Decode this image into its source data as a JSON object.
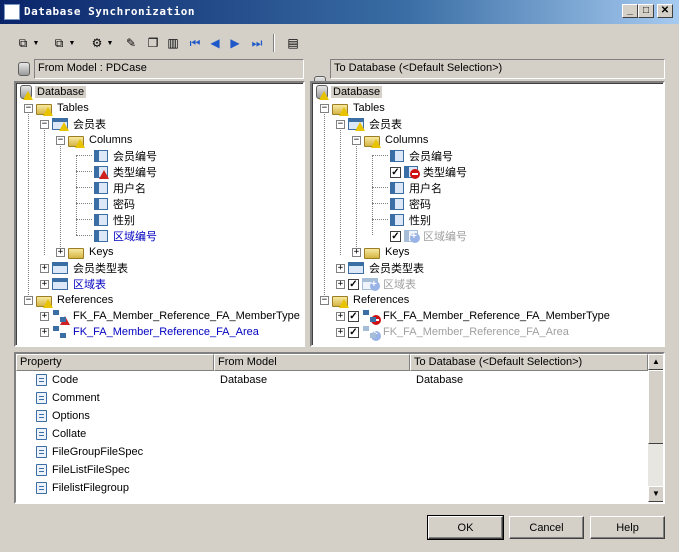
{
  "window": {
    "title": "Database Synchronization",
    "minimize_glyph": "_",
    "maximize_glyph": "□",
    "close_glyph": "✕"
  },
  "toolbar": {
    "icons": [
      "merge-icon",
      "dropdown-arrow",
      "compare-icon",
      "dropdown-arrow",
      "filter-icon",
      "dropdown-arrow",
      "properties-icon",
      "copy-icon",
      "columns-icon",
      "first-icon",
      "previous-icon",
      "next-icon",
      "last-icon",
      "report-icon"
    ]
  },
  "left_header": "From Model : PDCase",
  "right_header": "To Database (<Default Selection>)",
  "left_tree": [
    {
      "label": "Database"
    },
    {
      "label": "Tables"
    },
    {
      "label": "会员表"
    },
    {
      "label": "Columns"
    },
    {
      "label": "会员编号"
    },
    {
      "label": "类型编号"
    },
    {
      "label": "用户名"
    },
    {
      "label": "密码"
    },
    {
      "label": "性别"
    },
    {
      "label": "区域编号"
    },
    {
      "label": "Keys"
    },
    {
      "label": "会员类型表"
    },
    {
      "label": "区域表"
    },
    {
      "label": "References"
    },
    {
      "label": "FK_FA_Member_Reference_FA_MemberType"
    },
    {
      "label": "FK_FA_Member_Reference_FA_Area"
    }
  ],
  "right_tree": [
    {
      "label": "Database"
    },
    {
      "label": "Tables"
    },
    {
      "label": "会员表"
    },
    {
      "label": "Columns"
    },
    {
      "label": "会员编号"
    },
    {
      "label": "类型编号"
    },
    {
      "label": "用户名"
    },
    {
      "label": "密码"
    },
    {
      "label": "性别"
    },
    {
      "label": "区域编号"
    },
    {
      "label": "Keys"
    },
    {
      "label": "会员类型表"
    },
    {
      "label": "区域表"
    },
    {
      "label": "References"
    },
    {
      "label": "FK_FA_Member_Reference_FA_MemberType"
    },
    {
      "label": "FK_FA_Member_Reference_FA_Area"
    }
  ],
  "grid": {
    "columns": [
      "Property",
      "From Model",
      "To Database (<Default Selection>)"
    ],
    "rows": [
      {
        "property": "Code",
        "from": "Database",
        "to": "Database"
      },
      {
        "property": "Comment",
        "from": "",
        "to": ""
      },
      {
        "property": "Options",
        "from": "",
        "to": ""
      },
      {
        "property": "Collate",
        "from": "",
        "to": ""
      },
      {
        "property": "FileGroupFileSpec",
        "from": "",
        "to": ""
      },
      {
        "property": "FileListFileSpec",
        "from": "",
        "to": ""
      },
      {
        "property": "FilelistFilegroup",
        "from": "",
        "to": ""
      }
    ]
  },
  "buttons": {
    "ok": "OK",
    "cancel": "Cancel",
    "help": "Help"
  }
}
